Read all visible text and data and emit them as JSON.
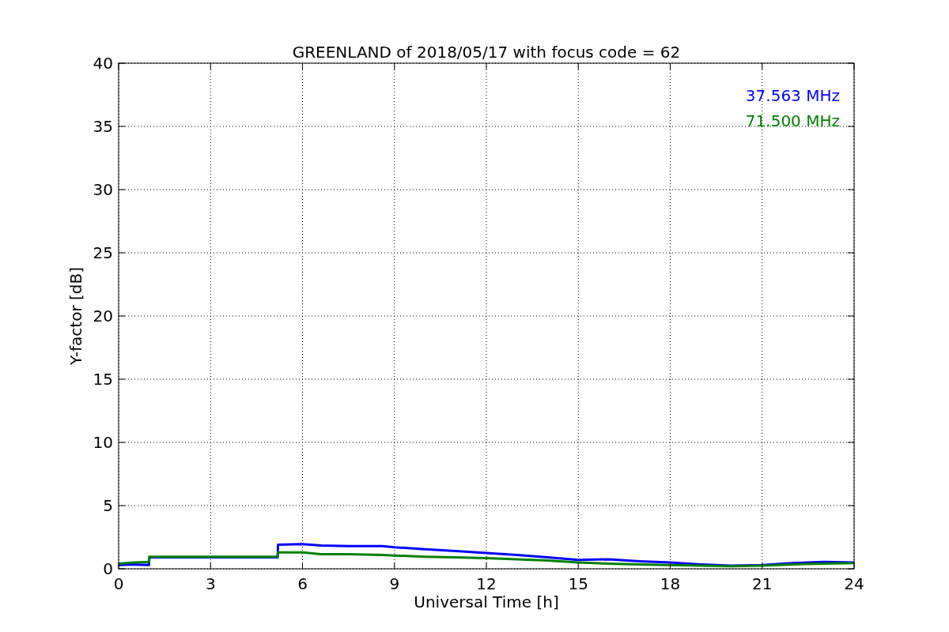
{
  "chart_data": {
    "type": "line",
    "title": "GREENLAND of 2018/05/17 with focus code = 62",
    "xlabel": "Universal Time [h]",
    "ylabel": "Y-factor [dB]",
    "x": [
      0,
      0.5,
      0.99,
      1,
      3,
      5.19,
      5.2,
      6,
      6.6,
      7.5,
      8.6,
      9,
      10,
      11,
      12,
      13,
      14,
      15,
      16,
      17,
      18,
      19,
      20,
      21,
      22,
      23,
      24
    ],
    "series": [
      {
        "name": "37.563 MHz",
        "color": "#0000ff",
        "values": [
          0.3,
          0.35,
          0.3,
          0.9,
          0.9,
          0.9,
          1.9,
          1.95,
          1.85,
          1.8,
          1.8,
          1.7,
          1.55,
          1.4,
          1.25,
          1.1,
          0.9,
          0.7,
          0.75,
          0.6,
          0.5,
          0.35,
          0.25,
          0.3,
          0.45,
          0.55,
          0.5
        ]
      },
      {
        "name": "71.500 MHz",
        "color": "#008000",
        "values": [
          0.4,
          0.5,
          0.55,
          0.95,
          0.95,
          0.95,
          1.3,
          1.3,
          1.15,
          1.15,
          1.1,
          1.05,
          0.95,
          0.9,
          0.85,
          0.75,
          0.65,
          0.5,
          0.4,
          0.35,
          0.3,
          0.25,
          0.2,
          0.25,
          0.35,
          0.4,
          0.45
        ]
      }
    ],
    "grid": true,
    "xlim": [
      0,
      24
    ],
    "ylim": [
      0,
      40
    ],
    "xticks": [
      0,
      3,
      6,
      9,
      12,
      15,
      18,
      21,
      24
    ],
    "yticks": [
      0,
      5,
      10,
      15,
      20,
      25,
      30,
      35,
      40
    ]
  }
}
